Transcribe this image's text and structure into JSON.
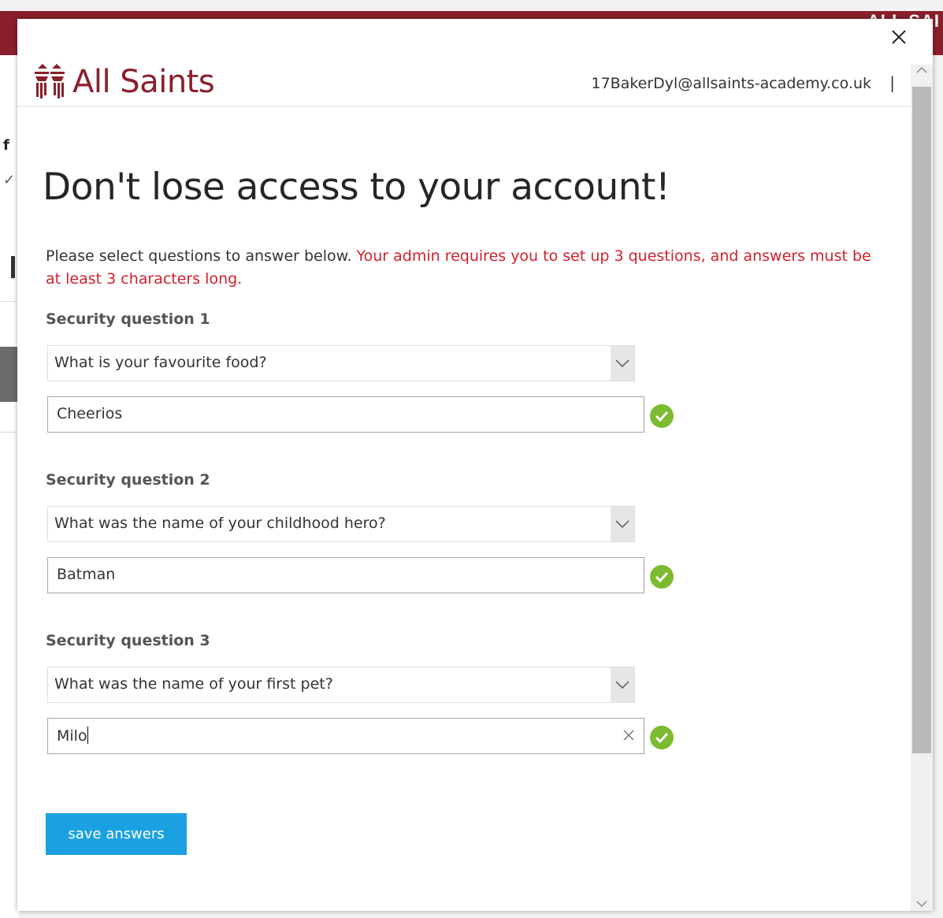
{
  "background": {
    "banner_text": "ALL SAI",
    "side_glyph": "f"
  },
  "dialog": {
    "close_icon": "close-icon",
    "logo": {
      "text": "All Saints",
      "color": "#8a1f2c"
    },
    "user": {
      "email": "17BakerDyl@allsaints-academy.co.uk",
      "separator": "|"
    },
    "title": "Don't lose access to your account!",
    "instructions": {
      "plain": "Please select questions to answer below. ",
      "warning": "Your admin requires you to set up 3 questions, and answers must be at least 3 characters long.",
      "warning_color": "#d0202c"
    },
    "questions": [
      {
        "label": "Security question 1",
        "question": "What is your favourite food?",
        "answer": "Cheerios",
        "valid": true
      },
      {
        "label": "Security question 2",
        "question": "What was the name of your childhood hero?",
        "answer": "Batman",
        "valid": true
      },
      {
        "label": "Security question 3",
        "question": "What was the name of your first pet?",
        "answer": "Milo",
        "valid": true,
        "focused": true
      }
    ],
    "save_button": {
      "label": "save answers",
      "color": "#1ba1e2"
    },
    "valid_color": "#7cbb2f"
  }
}
